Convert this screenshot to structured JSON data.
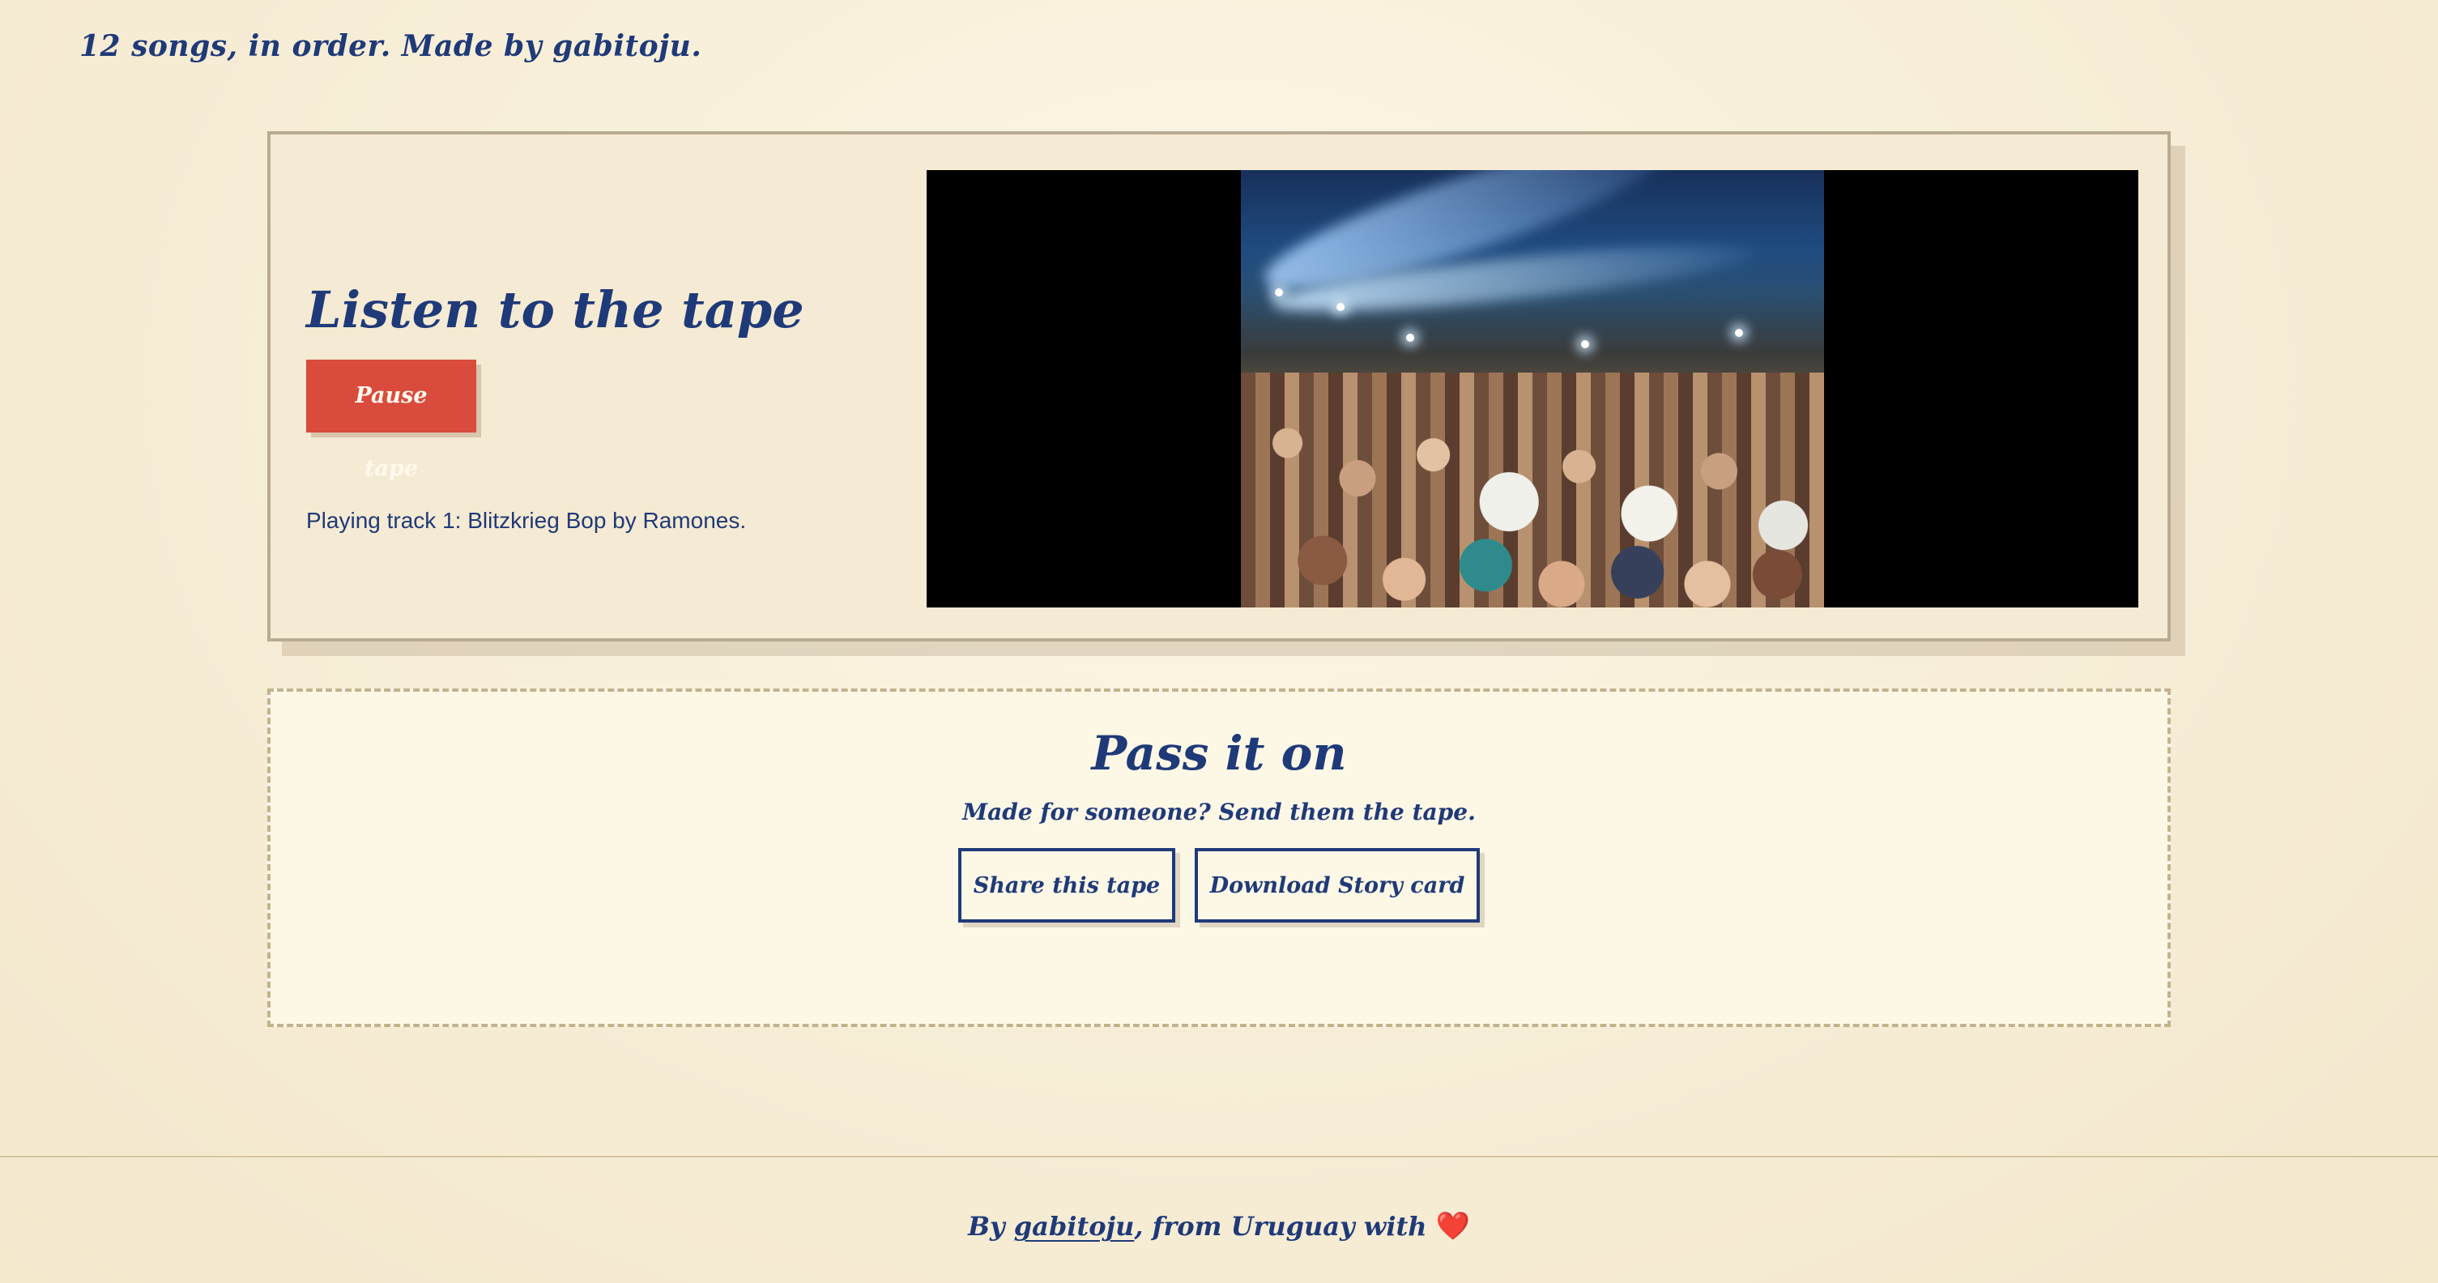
{
  "header": {
    "caption": "12 songs, in order. Made by gabitoju."
  },
  "player": {
    "title": "Listen to the tape",
    "pause_label": "Pause tape",
    "status": "Playing track 1: Blitzkrieg Bop by Ramones."
  },
  "share": {
    "title": "Pass it on",
    "subtitle": "Made for someone? Send them the tape.",
    "share_label": "Share this tape",
    "download_label": "Download Story card"
  },
  "footer": {
    "prefix": "By ",
    "author": "gabitoju",
    "suffix": ", from Uruguay with ",
    "heart": "❤️"
  },
  "colors": {
    "text_primary": "#1f3a78",
    "button_accent": "#d94c3d",
    "background": "#f8efd9"
  },
  "icons": {
    "heart": "heart-icon"
  }
}
